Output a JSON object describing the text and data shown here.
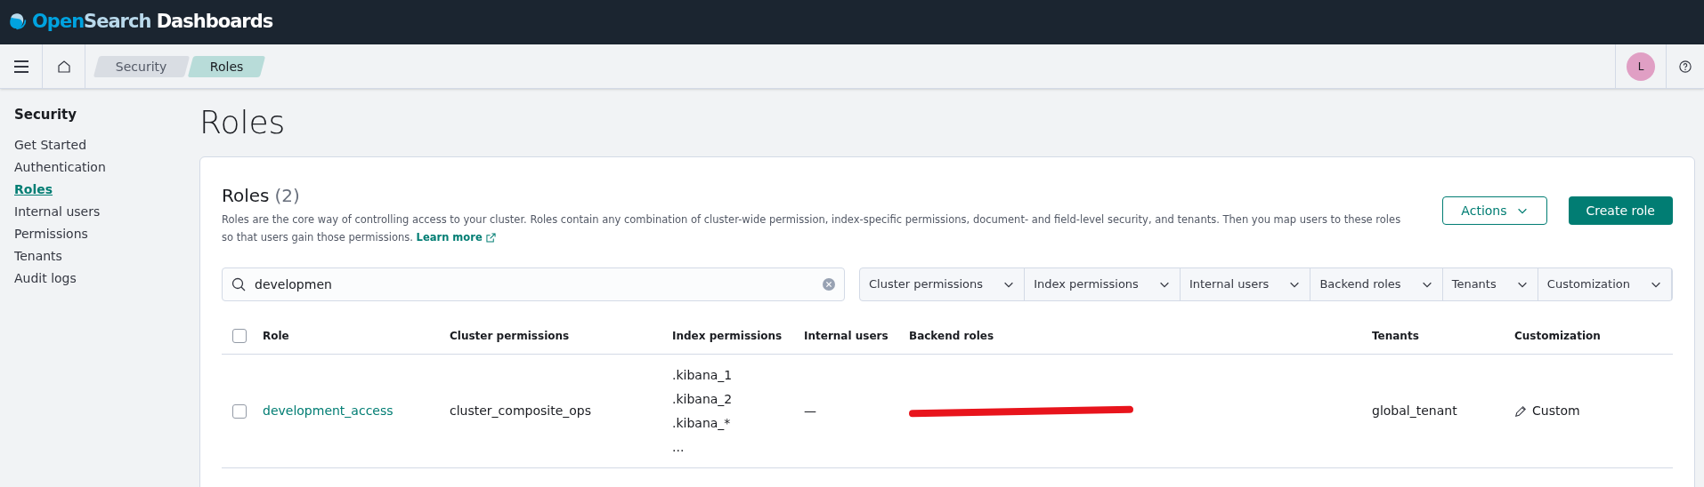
{
  "header": {
    "brand_first": "Open",
    "brand_second": "Search",
    "brand_third": "Dashboards"
  },
  "breadcrumbs": [
    {
      "label": "Security",
      "selected": false
    },
    {
      "label": "Roles",
      "selected": true
    }
  ],
  "user": {
    "initial": "L"
  },
  "sidebar": {
    "title": "Security",
    "items": [
      {
        "label": "Get Started",
        "selected": false
      },
      {
        "label": "Authentication",
        "selected": false
      },
      {
        "label": "Roles",
        "selected": true
      },
      {
        "label": "Internal users",
        "selected": false
      },
      {
        "label": "Permissions",
        "selected": false
      },
      {
        "label": "Tenants",
        "selected": false
      },
      {
        "label": "Audit logs",
        "selected": false
      }
    ]
  },
  "page_title": "Roles",
  "panel": {
    "title": "Roles",
    "count": "(2)",
    "description": "Roles are the core way of controlling access to your cluster. Roles contain any combination of cluster-wide permission, index-specific permissions, document- and field-level security, and tenants. Then you map users to these roles so that users gain those permissions.",
    "link": "Learn more",
    "actions_button": "Actions",
    "create_button": "Create role"
  },
  "search": {
    "value": "developmen"
  },
  "filters": [
    "Cluster permissions",
    "Index permissions",
    "Internal users",
    "Backend roles",
    "Tenants",
    "Customization"
  ],
  "table": {
    "select_all_checked": false,
    "columns": [
      "Role",
      "Cluster permissions",
      "Index permissions",
      "Internal users",
      "Backend roles",
      "Tenants",
      "Customization"
    ],
    "rows": [
      {
        "checked": false,
        "role": "development_access",
        "cluster_permissions": "cluster_composite_ops",
        "index_permissions": [
          ".kibana_1",
          ".kibana_2",
          ".kibana_*",
          "..."
        ],
        "internal_users": "—",
        "backend_roles_redacted": true,
        "tenants": "global_tenant",
        "customization": "Custom"
      }
    ]
  }
}
